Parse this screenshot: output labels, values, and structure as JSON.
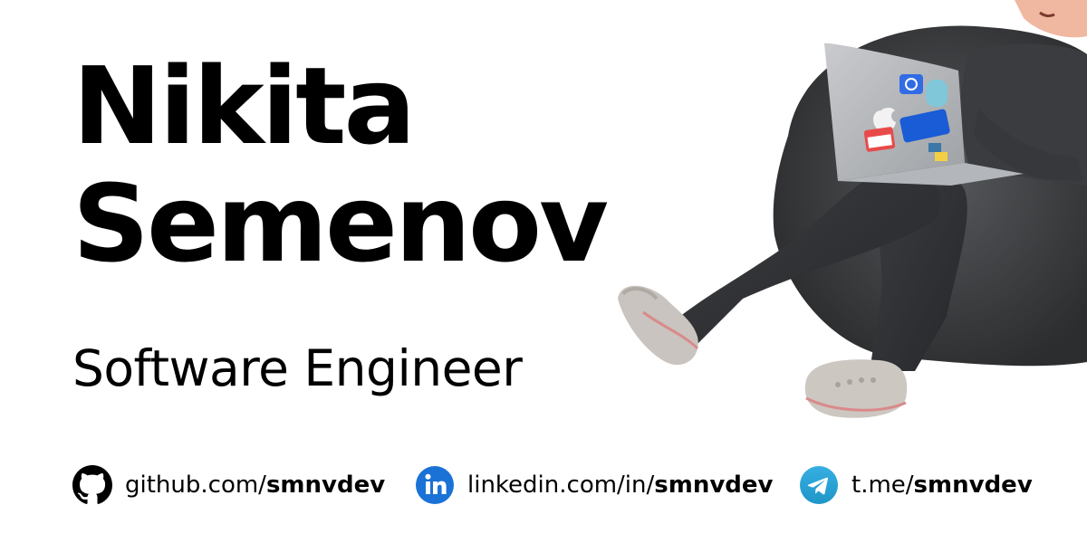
{
  "heading": {
    "first_name": "Nikita",
    "last_name": "Semenov"
  },
  "role": "Software Engineer",
  "links": [
    {
      "icon": "github-icon",
      "prefix": "github.com/",
      "handle": "smnvdev",
      "color": "#000000"
    },
    {
      "icon": "linkedin-icon",
      "prefix": "linkedin.com/in/",
      "handle": "smnvdev",
      "color": "#1a72d6"
    },
    {
      "icon": "telegram-icon",
      "prefix": "t.me/",
      "handle": "smnvdev",
      "color": "#2aa3e0"
    }
  ],
  "illustration": {
    "subject": "3D character sitting in a bean bag with a laptop",
    "laptop_stickers": [
      "kubernetes-sticker",
      "apple-logo",
      "go-gopher-sticker",
      "aviasales-sticker",
      "hello-name-sticker",
      "python-sticker"
    ]
  }
}
